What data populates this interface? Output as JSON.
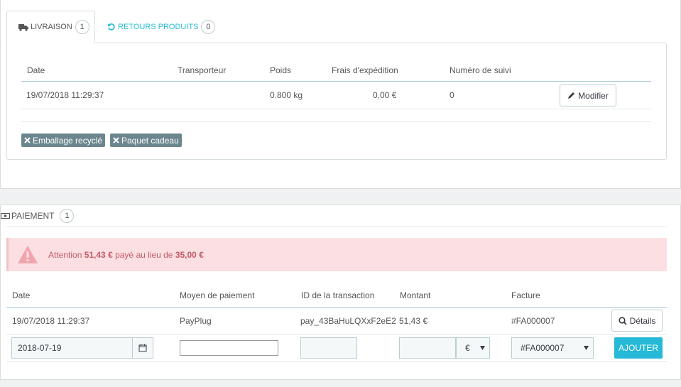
{
  "shipping_tabs": {
    "delivery": {
      "label": "LIVRAISON",
      "count": "1"
    },
    "returns": {
      "label": "RETOURS PRODUITS",
      "count": "0"
    }
  },
  "shipping_table": {
    "headers": [
      "Date",
      "Transporteur",
      "Poids",
      "Frais d'expédition",
      "Numéro de suivi"
    ],
    "row": {
      "date": "19/07/2018 11:29:37",
      "carrier": "",
      "weight": "0.800 kg",
      "cost": "0,00 €",
      "tracking": "0"
    },
    "edit_label": "Modifier"
  },
  "tags": [
    "Emballage recyclé",
    "Paquet cadeau"
  ],
  "payment": {
    "title": "PAIEMENT",
    "count": "1",
    "alert": {
      "prefix": "Attention ",
      "paid": "51,43 €",
      "middle": " payé au lieu de ",
      "expected": "35,00 €"
    },
    "headers": [
      "Date",
      "Moyen de paiement",
      "ID de la transaction",
      "Montant",
      "Facture"
    ],
    "row": {
      "date": "19/07/2018 11:29:37",
      "method": "PayPlug",
      "transaction": "pay_43BaHuLQXxF2eE2",
      "amount": "51,43 €",
      "invoice": "#FA000007"
    },
    "details_label": "Détails",
    "form": {
      "date": "2018-07-19",
      "currency": "€",
      "invoice": "#FA000007",
      "add_label": "AJOUTER"
    }
  },
  "colors": {
    "accent": "#25b9d7",
    "tag": "#6c868e",
    "alert_bg": "#fbdfe2",
    "alert_text": "#c05c67"
  }
}
